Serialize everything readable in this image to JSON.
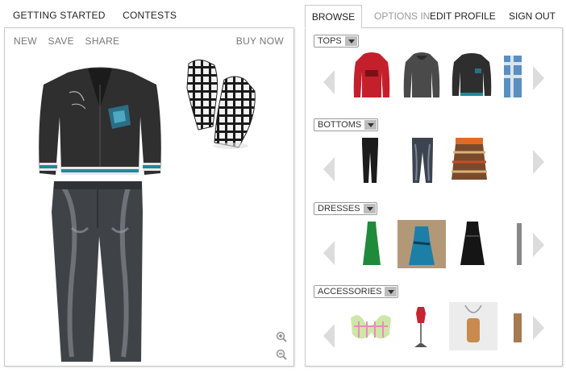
{
  "topnav": {
    "getting_started": "GETTING STARTED",
    "contests": "CONTESTS"
  },
  "outfit_toolbar": {
    "new": "NEW",
    "save": "SAVE",
    "share": "SHARE",
    "buy_now": "BUY NOW"
  },
  "tabs": {
    "browse": "BROWSE",
    "options": "OPTIONS IN",
    "options_faded": "EDIT PROFILE",
    "edit_profile": "EDIT PROFILE",
    "sign_out": "SIGN OUT"
  },
  "categories": [
    {
      "label": "TOPS"
    },
    {
      "label": "BOTTOMS"
    },
    {
      "label": "DRESSES"
    },
    {
      "label": "ACCESSORIES"
    }
  ],
  "icons": {
    "zoom_in": "zoom-in-icon",
    "zoom_out": "zoom-out-icon",
    "prev": "arrow-left-icon",
    "next": "arrow-right-icon",
    "dropdown": "chevron-down-icon"
  },
  "colors": {
    "border": "#c7c7c7",
    "arrow": "#dcdcdc",
    "text_muted": "#777777"
  }
}
